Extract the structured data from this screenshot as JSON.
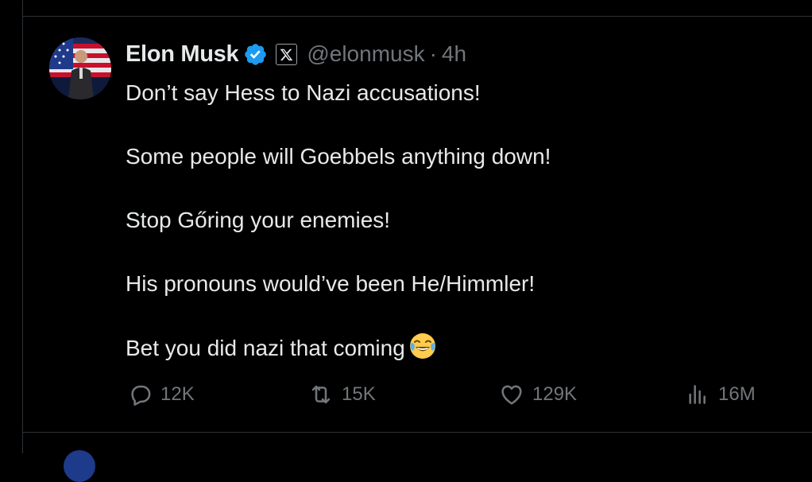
{
  "post": {
    "author_name": "Elon Musk",
    "handle": "@elonmusk",
    "separator": "·",
    "time": "4h",
    "lines": [
      "Don’t say Hess to Nazi accusations!",
      "Some people will Goebbels anything down!",
      "Stop Gőring your enemies!",
      "His pronouns would’ve been He/Himmler!",
      "Bet you did nazi that coming"
    ],
    "emoji": "face-with-tears-of-joy",
    "verified_color": "#1d9bf0"
  },
  "actions": {
    "replies": "12K",
    "reposts": "15K",
    "likes": "129K",
    "views": "16M"
  },
  "icons": {
    "reply": "reply-icon",
    "repost": "repost-icon",
    "like": "heart-icon",
    "views": "views-icon",
    "affiliation": "x-logo-icon",
    "verified": "verified-badge-icon"
  }
}
